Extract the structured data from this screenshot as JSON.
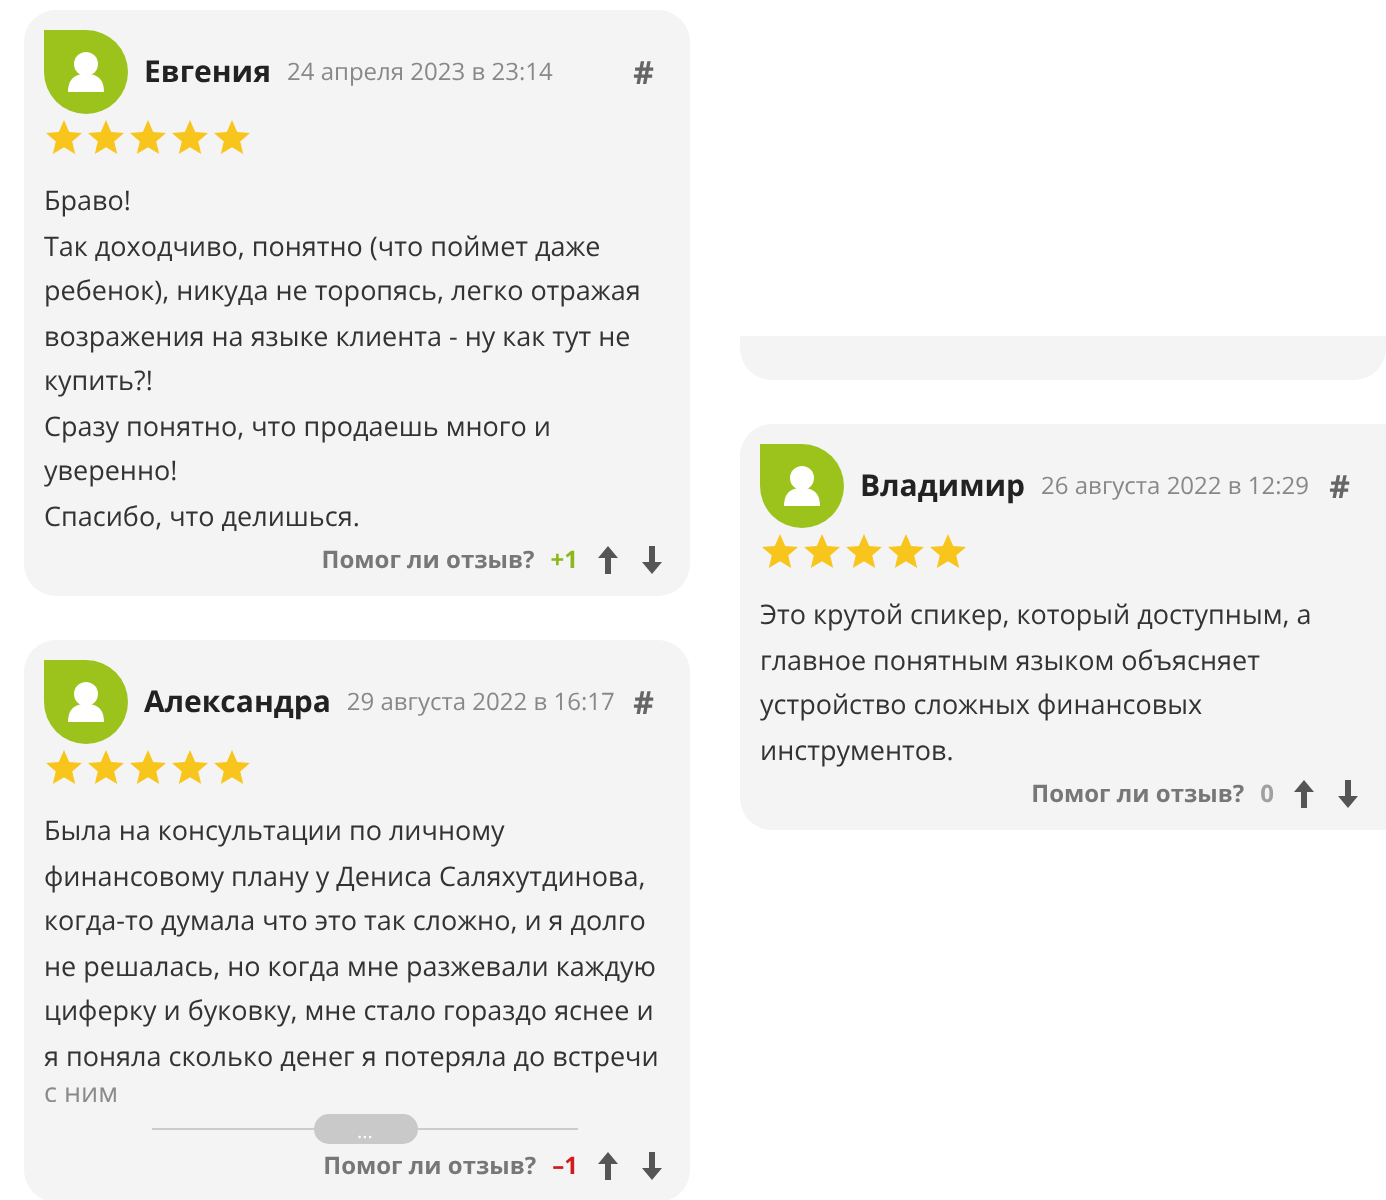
{
  "columns": [
    {
      "cards": [
        {
          "kind": "review",
          "author": "Евгения",
          "date": "24 апреля 2023 в 23:14",
          "anchor": "#",
          "stars": 5,
          "paragraphs": [
            "Браво!",
            "Так доходчиво, понятно (что поймет даже ребенок), никуда не торопясь, легко отражая возражения на языке клиента - ну как тут не купить?!",
            "Сразу понятно, что продаешь много и уверенно!",
            "Спасибо, что делишься."
          ],
          "helpful_label": "Помог ли отзыв?",
          "score": "+1",
          "color": "#8cb81c"
        },
        {
          "kind": "review",
          "author": "Александра",
          "date": "29 августа 2022 в 16:17",
          "anchor": "#",
          "stars": 5,
          "paragraphs": [
            "Была на консультации по личному финансовому плану у Дениса Саляхутдинова, когда-то думала что это так сложно, и я долго не решалась, но когда мне разжевали каждую циферку и буковку, мне стало гораздо яснее и я поняла сколько денег я потеряла до встречи"
          ],
          "faded_tail": "с ним",
          "expand_button": "...",
          "helpful_label": "Помог ли отзыв?",
          "score": "–1",
          "color": "#d01c1c"
        }
      ]
    },
    {
      "cards": [
        {
          "kind": "fragment"
        },
        {
          "kind": "review",
          "author": "Владимир",
          "date": "26 августа 2022 в 12:29",
          "anchor": "#",
          "stars": 5,
          "paragraphs": [
            "Это крутой спикер, который доступным, а главное понятным языком объясняет устройство сложных финансовых инструментов."
          ],
          "helpful_label": "Помог ли отзыв?",
          "score": "0",
          "color": "#a0a0a0"
        }
      ]
    }
  ]
}
